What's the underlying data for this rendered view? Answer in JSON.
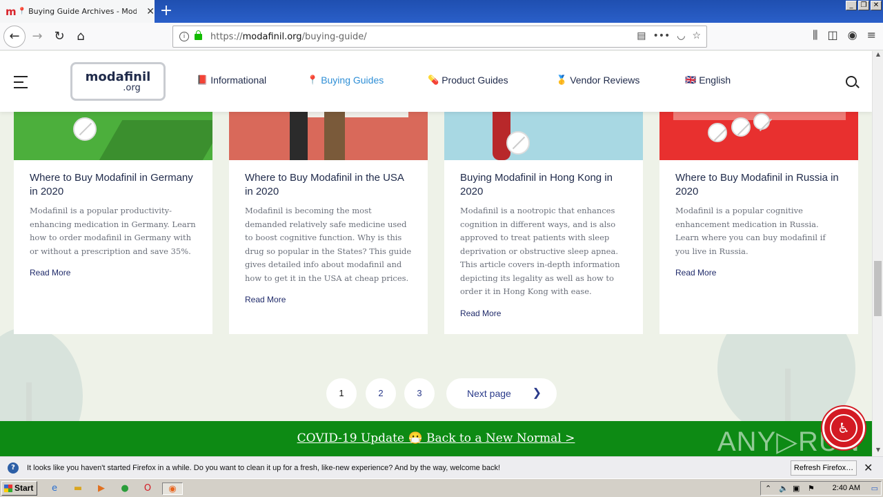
{
  "browser": {
    "tab_title": "Buying Guide Archives - Modafinil",
    "tab_favicon": "m",
    "url_prefix": "https://",
    "url_domain": "modafinil.org",
    "url_path": "/buying-guide/",
    "window_controls": [
      "_",
      "❐",
      "✕"
    ]
  },
  "site": {
    "logo_main": "modafinil",
    "logo_sub": ".org",
    "menu": [
      {
        "label": "Informational",
        "icon": "book-icon"
      },
      {
        "label": "Buying Guides",
        "icon": "pin-icon",
        "active": true
      },
      {
        "label": "Product Guides",
        "icon": "pill-icon"
      },
      {
        "label": "Vendor Reviews",
        "icon": "medal-icon"
      },
      {
        "label": "English",
        "icon": "uk-flag-icon"
      }
    ]
  },
  "cards": [
    {
      "title": "Where to Buy Modafinil in Germany in 2020",
      "text": "Modafinil is a popular productivity-enhancing medication in Germany. Learn how to order modafinil in Germany with or without a prescription and save 35%.",
      "more": "Read More",
      "color": "#4caf3c"
    },
    {
      "title": "Where to Buy Modafinil in the USA in 2020",
      "text": "Modafinil is becoming the most demanded relatively safe medicine used to boost cognitive function. Why is this drug so popular in the States? This guide gives detailed info about modafinil and how to get it in the USA at cheap prices.",
      "more": "Read More",
      "color": "#d9695a"
    },
    {
      "title": "Buying Modafinil in Hong Kong in 2020",
      "text": "Modafinil is a nootropic that enhances cognition in different ways, and is also approved to treat patients with sleep deprivation or obstructive sleep apnea. This article covers in-depth information depicting its legality as well as how to order it in Hong Kong with ease.",
      "more": "Read More",
      "color": "#a8d8e3"
    },
    {
      "title": "Where to Buy Modafinil in Russia in 2020",
      "text": "Modafinil is a popular cognitive enhancement medication in Russia. Learn where you can buy modafinil if you live in Russia.",
      "more": "Read More",
      "color": "#e8302f"
    }
  ],
  "pagination": {
    "pages": [
      "1",
      "2",
      "3"
    ],
    "current": "1",
    "next_label": "Next page"
  },
  "covid_banner": "COVID-19 Update 😷 Back to a New Normal >",
  "watermark": "ANY▷RUN",
  "notification": {
    "text": "It looks like you haven't started Firefox in a while. Do you want to clean it up for a fresh, like-new experience? And by the way, welcome back!",
    "button": "Refresh Firefox…"
  },
  "taskbar": {
    "start": "Start",
    "clock": "2:40 AM"
  }
}
